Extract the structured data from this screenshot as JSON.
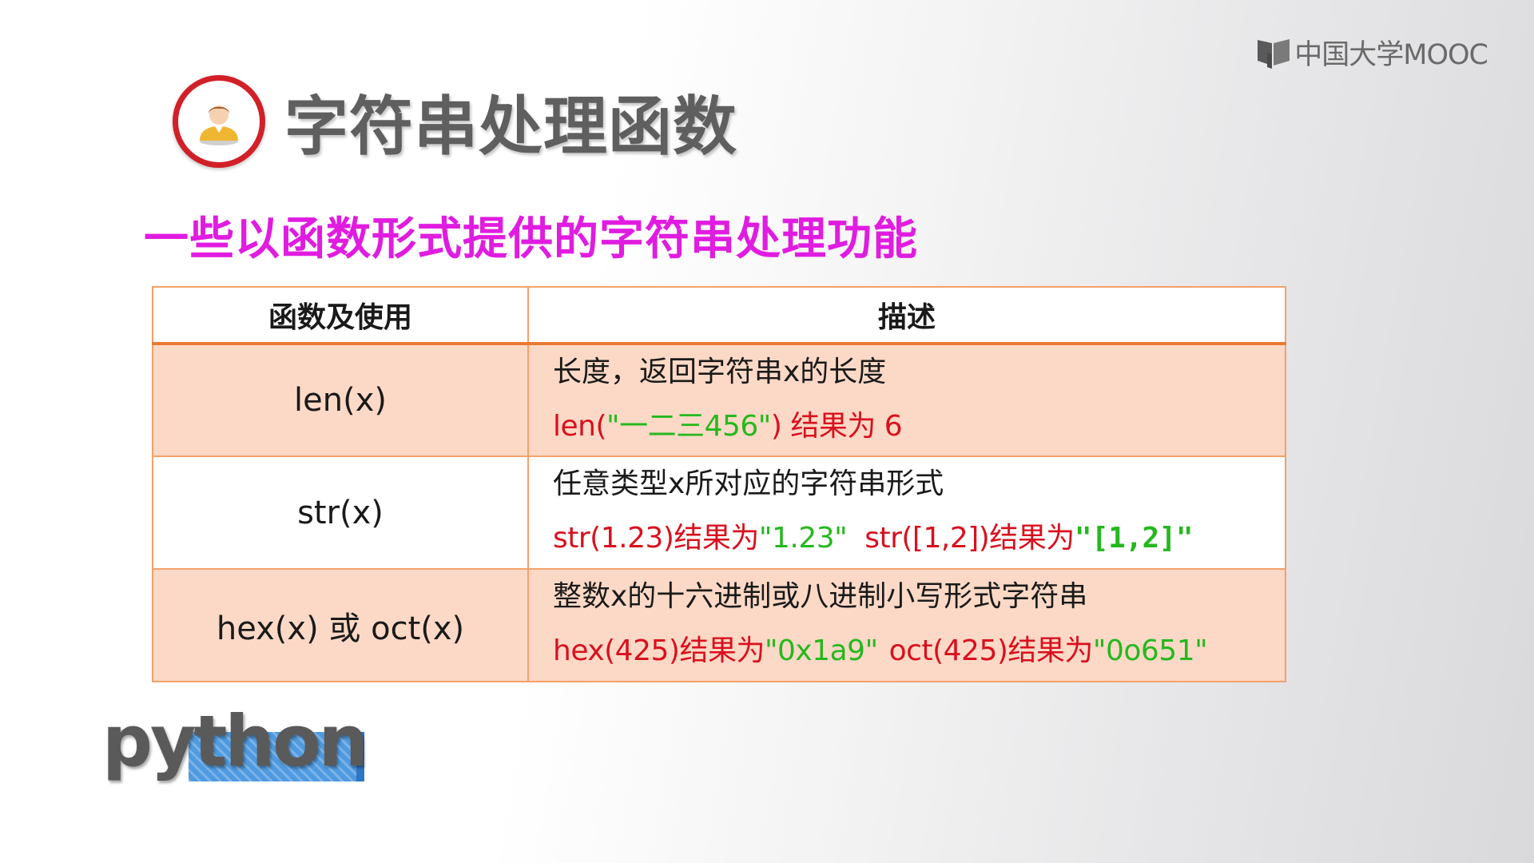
{
  "brand": {
    "logo_text": "中国大学MOOC"
  },
  "slide": {
    "title": "字符串处理函数",
    "subtitle": "一些以函数形式提供的字符串处理功能"
  },
  "table": {
    "headers": [
      "函数及使用",
      "描述"
    ],
    "rows": [
      {
        "function": "len(x)",
        "description": "长度，返回字符串x的长度",
        "example": {
          "a": "len(",
          "b": "\"一二三456\"",
          "c": ") 结果为 6"
        }
      },
      {
        "function": "str(x)",
        "description": "任意类型x所对应的字符串形式",
        "example": {
          "a": "str(1.23)结果为",
          "b": "\"1.23\"",
          "c": "str([1,2])结果为",
          "d": "\"[1,2]\""
        }
      },
      {
        "function": "hex(x) 或 oct(x)",
        "description": "整数x的十六进制或八进制小写形式字符串",
        "example": {
          "a": "hex(425)结果为",
          "b": "\"0x1a9\"",
          "c": "oct(425)结果为",
          "d": "\"0o651\""
        }
      }
    ]
  },
  "python_logo": {
    "text": "python"
  },
  "colors": {
    "title_gray": "#5f5f5f",
    "subtitle_magenta": "#e01ce0",
    "table_border_orange": "#f4a06a",
    "row_fill_peach": "#fcd9c6",
    "example_red": "#d9101e",
    "example_green": "#25b81e",
    "avatar_ring_red": "#d12027"
  },
  "icons": {
    "title_icon": "person-avatar-icon",
    "brand_icon": "mooc-book-icon"
  }
}
